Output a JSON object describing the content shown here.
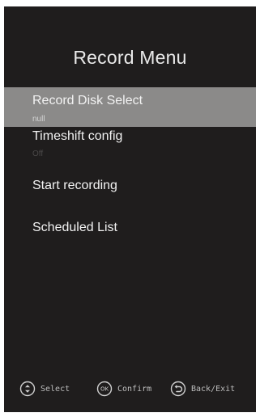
{
  "menu": {
    "title": "Record Menu",
    "items": [
      {
        "label": "Record Disk Select",
        "value": "null",
        "selected": true
      },
      {
        "label": "Timeshift config",
        "value": "Off",
        "selected": false
      },
      {
        "label": "Start recording",
        "value": "",
        "selected": false
      },
      {
        "label": "Scheduled List",
        "value": "",
        "selected": false
      }
    ]
  },
  "hints": {
    "select_label": "Select",
    "select_icon": "up-down-nav-icon",
    "confirm_label": "Confirm",
    "confirm_icon": "ok-button-icon",
    "back_label": "Back/Exit",
    "back_icon": "back-arrow-icon"
  },
  "colors": {
    "panel_background": "#1f1d1d",
    "selected_background": "#8b8a89",
    "text": "#f2f2f2",
    "hint_text": "#bdbdbd"
  }
}
